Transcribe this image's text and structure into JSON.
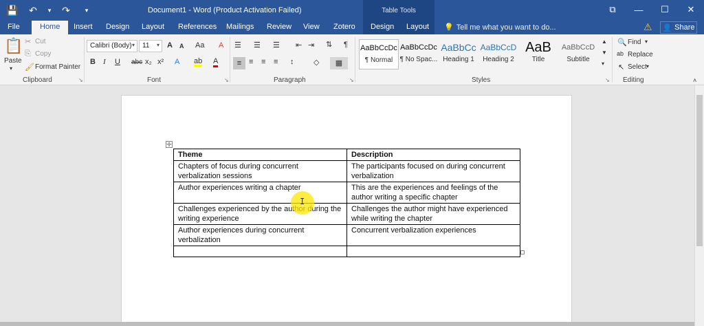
{
  "window": {
    "title": "Document1 - Word (Product Activation Failed)",
    "context_title": "Table Tools",
    "controls": {
      "ribbon_display": "⧉",
      "minimize": "—",
      "maximize": "☐",
      "close": "✕"
    }
  },
  "qat": {
    "save": "💾",
    "undo": "↶",
    "undo_dd": "▾",
    "redo": "↷",
    "customize": "▾"
  },
  "tabs": {
    "file": "File",
    "home": "Home",
    "insert": "Insert",
    "design": "Design",
    "layout": "Layout",
    "references": "References",
    "mailings": "Mailings",
    "review": "Review",
    "view": "View",
    "zotero": "Zotero",
    "table_design": "Design",
    "table_layout": "Layout"
  },
  "tell_me": {
    "icon": "💡",
    "text": "Tell me what you want to do..."
  },
  "share": {
    "icon": "👤",
    "label": "Share"
  },
  "clipboard": {
    "paste": "Paste",
    "cut": "Cut",
    "copy": "Copy",
    "format_painter": "Format Painter",
    "label": "Clipboard"
  },
  "font": {
    "name": "Calibri (Body)",
    "size": "11",
    "grow": "A",
    "shrink": "A",
    "case": "Aa",
    "clear": "A",
    "bold": "B",
    "italic": "I",
    "underline": "U",
    "strike": "abc",
    "subscript": "x₂",
    "superscript": "x²",
    "effects": "A",
    "highlight": "ab",
    "color": "A",
    "label": "Font"
  },
  "paragraph": {
    "label": "Paragraph",
    "pilcrow": "¶"
  },
  "styles": {
    "label": "Styles",
    "items": [
      {
        "preview": "AaBbCcDc",
        "name": "¶ Normal"
      },
      {
        "preview": "AaBbCcDc",
        "name": "¶ No Spac..."
      },
      {
        "preview": "AaBbCc",
        "name": "Heading 1"
      },
      {
        "preview": "AaBbCcD",
        "name": "Heading 2"
      },
      {
        "preview": "AaB",
        "name": "Title"
      },
      {
        "preview": "AaBbCcD",
        "name": "Subtitle"
      }
    ]
  },
  "editing": {
    "find": "Find",
    "replace": "Replace",
    "select": "Select",
    "label": "Editing"
  },
  "table": {
    "header": [
      "Theme",
      "Description"
    ],
    "rows": [
      [
        "Chapters of focus during concurrent verbalization sessions",
        "The participants focused on  during concurrent verbalization"
      ],
      [
        "Author experiences writing a chapter",
        "This are the experiences and feelings of the author writing a specific chapter"
      ],
      [
        "Challenges experienced by the author during the writing experience",
        "Challenges the author might have experienced while writing the chapter"
      ],
      [
        "Author experiences  during concurrent verbalization",
        "Concurrent verbalization experiences"
      ],
      [
        "",
        ""
      ]
    ]
  }
}
